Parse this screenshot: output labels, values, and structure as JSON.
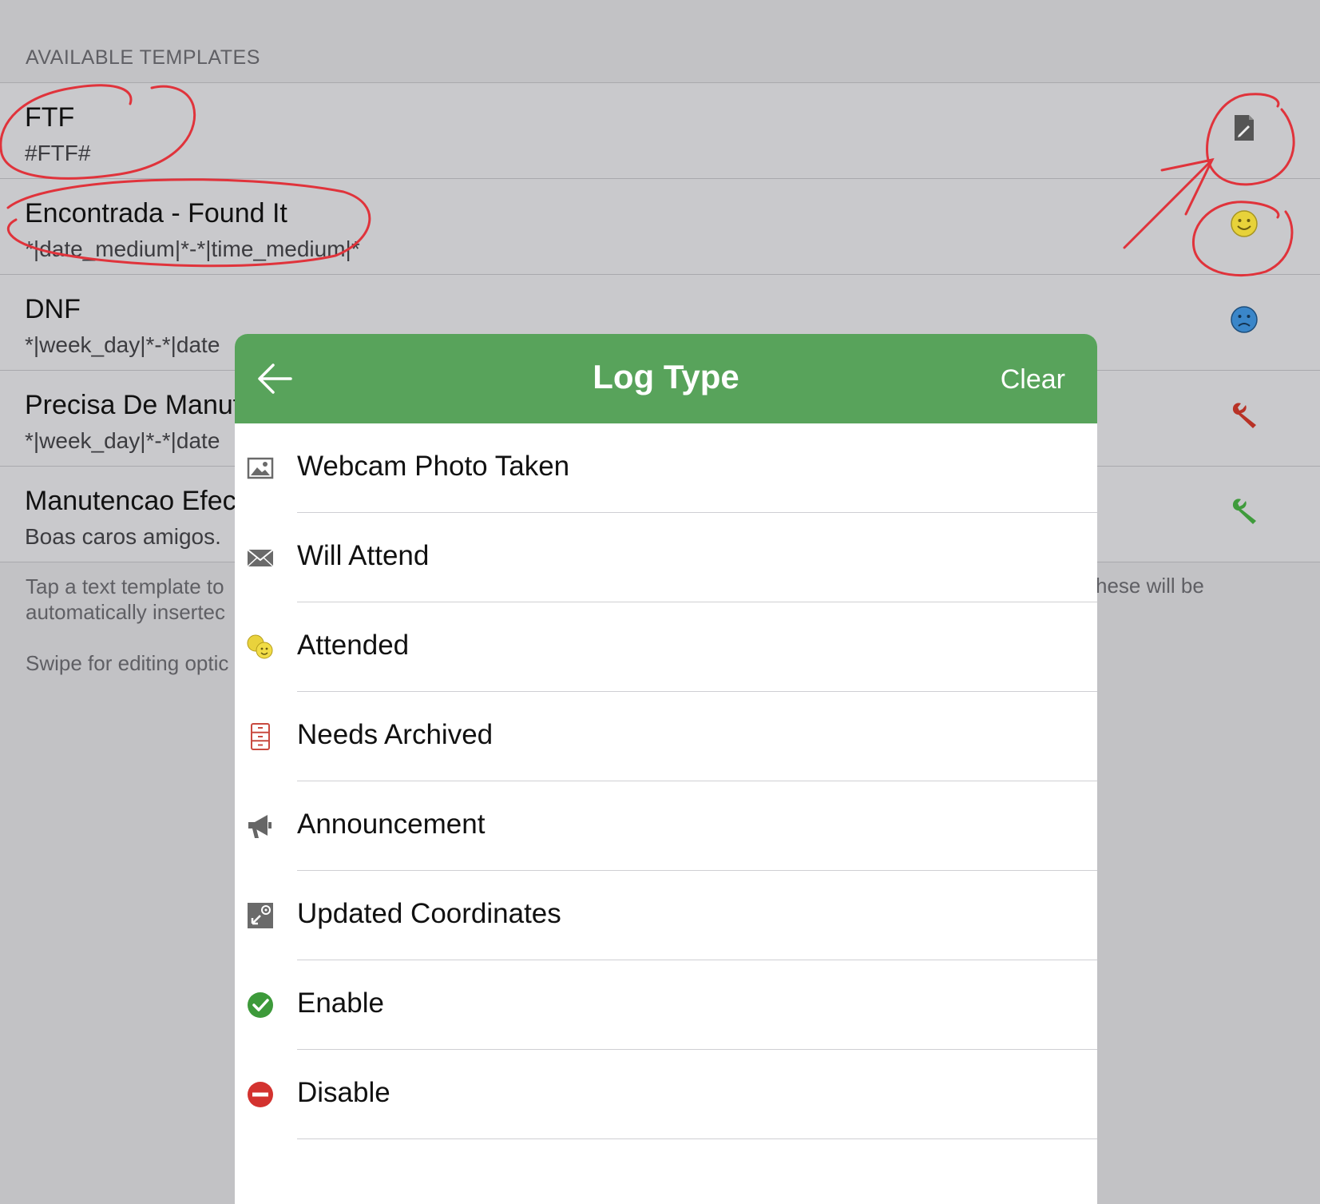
{
  "templates_section": {
    "header": "AVAILABLE TEMPLATES",
    "items": [
      {
        "title": "FTF",
        "body": "#FTF#",
        "icon": "note-edit-icon",
        "icon_color": "#4a4a4a"
      },
      {
        "title": "Encontrada - Found It",
        "body": "*|date_medium|*-*|time_medium|*",
        "icon": "smiley-icon",
        "icon_color": "#d6c12a"
      },
      {
        "title": "DNF",
        "body": "*|week_day|*-*|date",
        "icon": "frown-icon",
        "icon_color": "#2f7fc4"
      },
      {
        "title": "Precisa De Manut",
        "body": "*|week_day|*-*|date",
        "icon": "wrench-red-icon",
        "icon_color": "#c0392b"
      },
      {
        "title": "Manutencao Efec",
        "body": "Boas caros amigos.",
        "icon": "wrench-green-icon",
        "icon_color": "#3f9b3c"
      }
    ],
    "footer_line1": "Tap a text template to",
    "footer_line2": "automatically insertec",
    "footer_right": "hese will be",
    "footer_swipe": "Swipe for editing optic"
  },
  "modal": {
    "title": "Log Type",
    "clear_label": "Clear",
    "header_color": "#58a35b",
    "items": [
      {
        "label": "Webcam Photo Taken",
        "icon": "image-icon"
      },
      {
        "label": "Will Attend",
        "icon": "envelope-icon"
      },
      {
        "label": "Attended",
        "icon": "two-smileys-icon"
      },
      {
        "label": "Needs Archived",
        "icon": "file-cabinet-icon"
      },
      {
        "label": "Announcement",
        "icon": "megaphone-icon"
      },
      {
        "label": "Updated Coordinates",
        "icon": "coordinates-icon"
      },
      {
        "label": "Enable",
        "icon": "check-circle-icon"
      },
      {
        "label": "Disable",
        "icon": "minus-circle-icon"
      }
    ]
  }
}
